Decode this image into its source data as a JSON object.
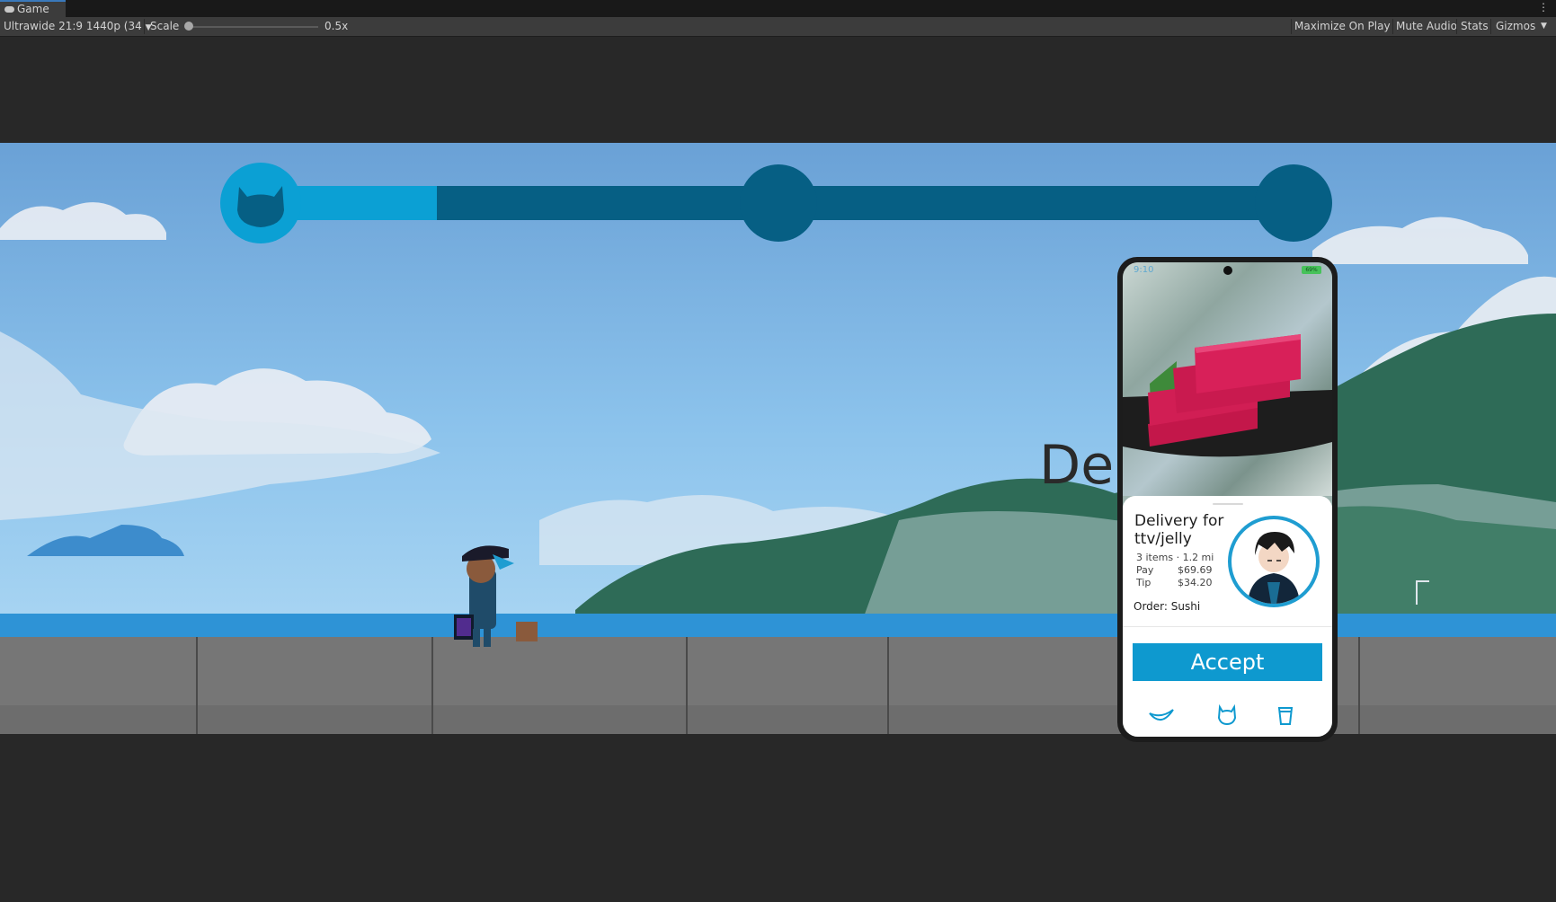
{
  "editor": {
    "tab_label": "Game",
    "resolution": "Ultrawide 21:9 1440p (34",
    "scale_label": "Scale",
    "scale_value": "0.5x",
    "toolbar_buttons": {
      "maximize": "Maximize On Play",
      "mute": "Mute Audio",
      "stats": "Stats",
      "gizmos": "Gizmos"
    }
  },
  "game": {
    "progress_fraction": 0.17,
    "milestones": 3,
    "background_text": "Del"
  },
  "phone": {
    "status_time": "9:10",
    "battery": "69%",
    "delivery_title": "Delivery for ttv/jelly",
    "meta": "3 items · 1.2 mi",
    "pay_label": "Pay",
    "pay_value": "$69.69",
    "tip_label": "Tip",
    "tip_value": "$34.20",
    "order_text": "Order: Sushi",
    "accept_label": "Accept",
    "nav_icons": [
      "fish-icon",
      "cat-icon",
      "cup-icon"
    ]
  },
  "colors": {
    "accent": "#0e99cf",
    "progress_fill": "#0ba0d4",
    "progress_track": "#065f84"
  }
}
